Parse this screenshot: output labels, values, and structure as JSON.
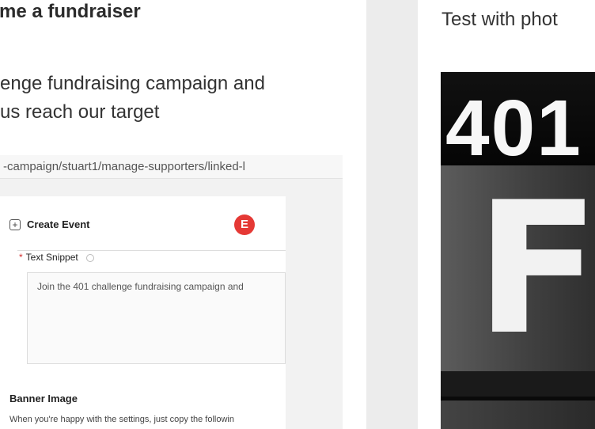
{
  "left_card": {
    "title": "me a fundraiser",
    "description_line1": "enge fundraising campaign and",
    "description_line2": "us reach our target",
    "screenshot": {
      "url": "-campaign/stuart1/manage-supporters/linked-l",
      "create_event_label": "Create Event",
      "create_event_icon": "plus-icon",
      "badge_letter": "E",
      "badge_color": "#e53935",
      "text_snippet_label": "Text Snippet",
      "text_snippet_value": "Join the 401 challenge fundraising campaign and",
      "banner_image_label": "Banner Image",
      "banner_image_desc": "When you're happy with the settings, just copy the followin"
    }
  },
  "right_card": {
    "title": "Test with phot",
    "photo": {
      "number_text": "401",
      "letter_text": "F"
    }
  }
}
